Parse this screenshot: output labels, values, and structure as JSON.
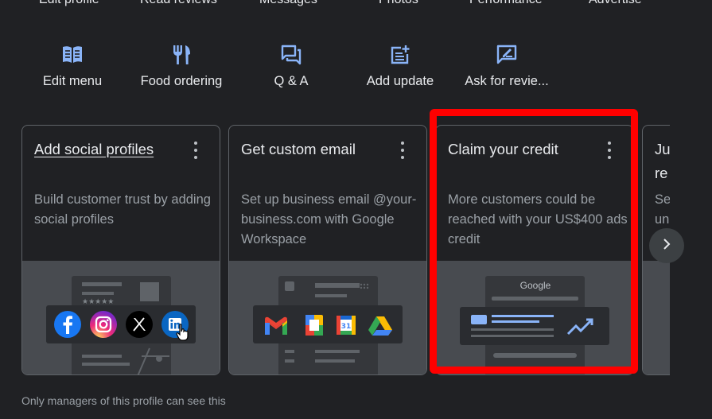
{
  "top_links": [
    "Edit profile",
    "Read reviews",
    "Messages",
    "Photos",
    "Performance",
    "Advertise"
  ],
  "actions": [
    {
      "label": "Edit menu",
      "icon": "menu-book-icon"
    },
    {
      "label": "Food ordering",
      "icon": "restaurant-icon"
    },
    {
      "label": "Q & A",
      "icon": "forum-icon"
    },
    {
      "label": "Add update",
      "icon": "post-add-icon"
    },
    {
      "label": "Ask for revie...",
      "icon": "rate-review-icon"
    }
  ],
  "cards": [
    {
      "title": "Add social profiles",
      "desc": "Build customer trust by adding social profiles",
      "icons": [
        "facebook-icon",
        "instagram-icon",
        "x-icon",
        "linkedin-icon"
      ]
    },
    {
      "title": "Get custom email",
      "desc": "Set up business email @your-business.com with Google Workspace",
      "icons": [
        "gmail-icon",
        "docs-icon",
        "calendar-icon",
        "drive-icon"
      ]
    },
    {
      "title": "Claim your credit",
      "desc": "More customers could be reached with your US$400 ads credit",
      "illus_text": "Google"
    },
    {
      "title": "Ju re",
      "desc": "Se un"
    }
  ],
  "footer": "Only managers of this profile can see this",
  "colors": {
    "background": "#202124",
    "icon_blue": "#8ab4f8",
    "highlight": "#ff0000",
    "muted_text": "#9aa0a6"
  }
}
